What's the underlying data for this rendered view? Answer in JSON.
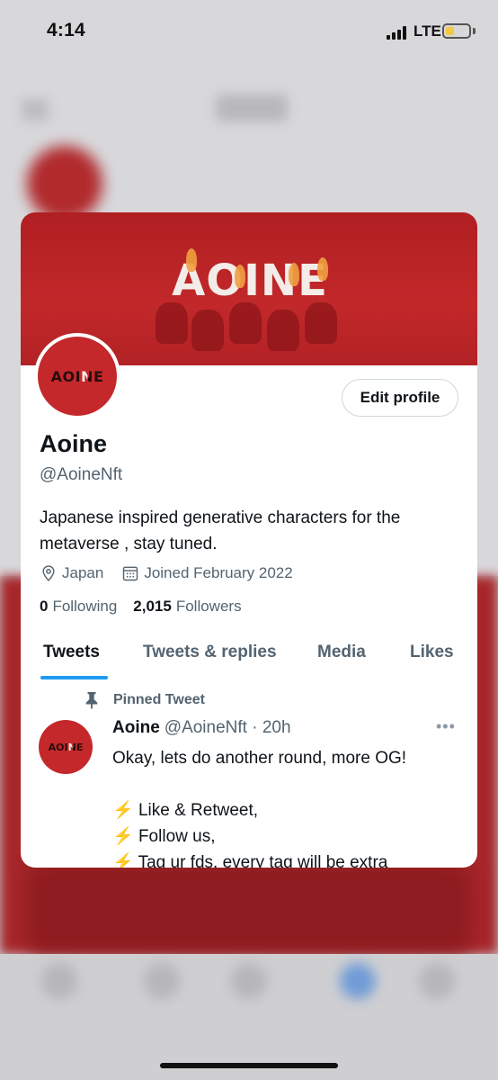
{
  "status_bar": {
    "time": "4:14",
    "network": "LTE"
  },
  "banner": {
    "logo_text": "AOINE"
  },
  "avatar": {
    "logo_text": "AOINE"
  },
  "profile": {
    "edit_label": "Edit profile",
    "display_name": "Aoine",
    "handle": "@AoineNft",
    "bio": "Japanese inspired generative characters for the metaverse , stay tuned.",
    "location": "Japan",
    "joined": "Joined February 2022",
    "following_count": "0",
    "following_label": "Following",
    "followers_count": "2,015",
    "followers_label": "Followers"
  },
  "tabs": [
    {
      "label": "Tweets"
    },
    {
      "label": "Tweets & replies"
    },
    {
      "label": "Media"
    },
    {
      "label": "Likes"
    }
  ],
  "pinned_tweet": {
    "pinned_label": "Pinned Tweet",
    "author_name": "Aoine",
    "author_meta": "@AoineNft · 20h",
    "more_label": "•••",
    "avatar_text": "AOINE",
    "lines": [
      "Okay, lets do another round, more OG!",
      "",
      "Like & Retweet,",
      "Follow us,",
      "Tag ur fds, every tag will be extra"
    ],
    "bolt_glyph": "⚡"
  },
  "colors": {
    "accent": "#1d9bf0",
    "banner_red": "#b01f22",
    "muted_text": "#536471"
  }
}
